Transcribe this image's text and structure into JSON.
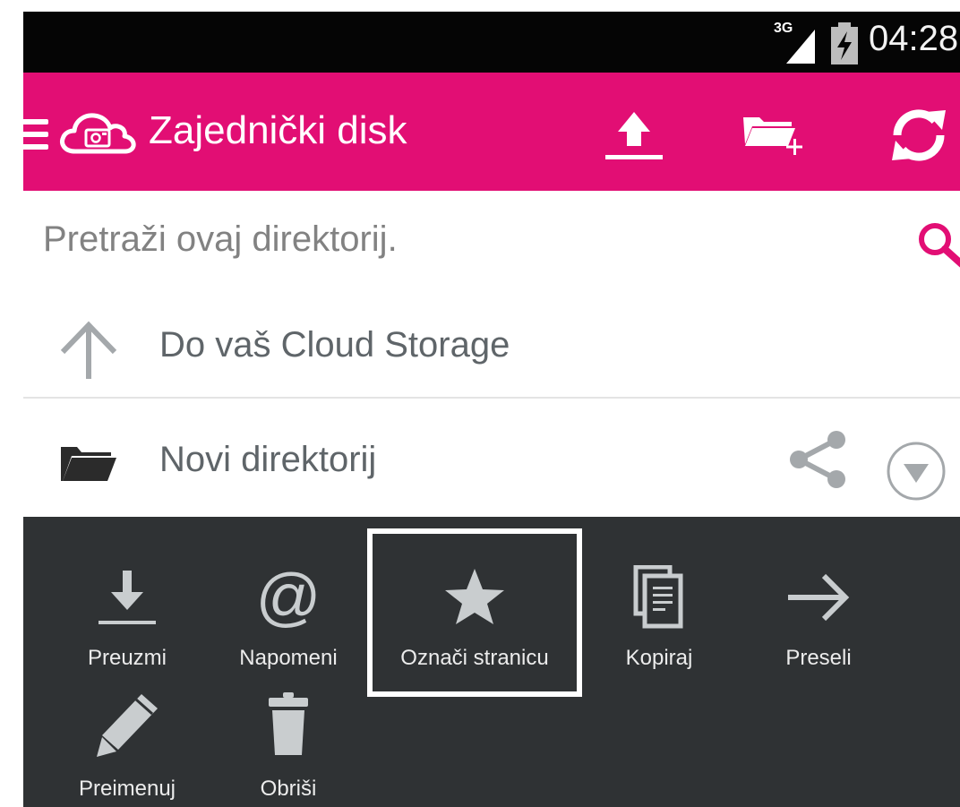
{
  "status_bar": {
    "network": "3G",
    "time": "04:28"
  },
  "app_bar": {
    "title": "Zajednički disk",
    "menu_icon": "hamburger-menu-icon",
    "logo_icon": "cloud-icon",
    "actions": [
      "upload-icon",
      "new-folder-icon",
      "refresh-icon"
    ]
  },
  "search": {
    "placeholder": "Pretraži ovaj direktorij.",
    "icon": "search-icon"
  },
  "list": {
    "up_item": {
      "label": "Do vaš Cloud Storage",
      "icon": "arrow-up-icon"
    },
    "folder_item": {
      "label": "Novi direktorij",
      "icon": "folder-icon"
    }
  },
  "actions_panel": {
    "items": [
      {
        "label": "Preuzmi",
        "icon": "download-icon"
      },
      {
        "label": "Napomeni",
        "icon": "at-sign-icon"
      },
      {
        "label": "Označi stranicu",
        "icon": "star-icon",
        "selected": true
      },
      {
        "label": "Kopiraj",
        "icon": "copy-icon"
      },
      {
        "label": "Preseli",
        "icon": "arrow-right-icon"
      },
      {
        "label": "Preimenuj",
        "icon": "pencil-icon"
      },
      {
        "label": "Obriši",
        "icon": "trash-icon"
      }
    ]
  },
  "colors": {
    "accent": "#e20e74",
    "panel": "#2f3234",
    "status_bar": "#050505",
    "text": "#5f6569",
    "icon_gray": "#bfc3c6"
  }
}
